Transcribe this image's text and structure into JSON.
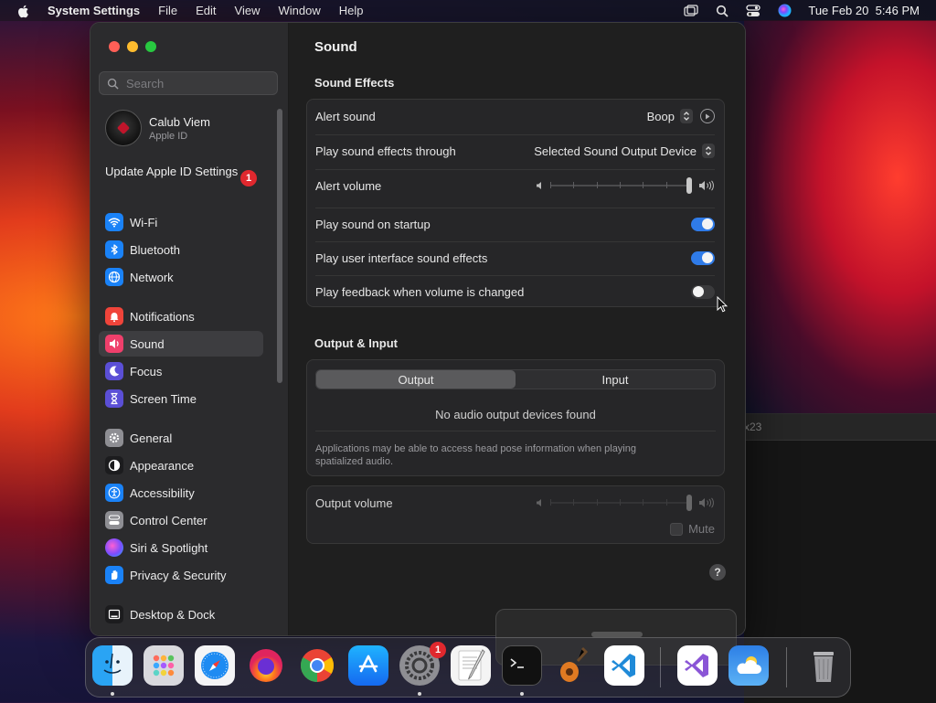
{
  "menubar": {
    "app_name": "System Settings",
    "menus": [
      "File",
      "Edit",
      "View",
      "Window",
      "Help"
    ],
    "clock": "Tue Feb 20  5:46 PM"
  },
  "background": {
    "terminal_fragment": "x23"
  },
  "sidebar": {
    "search_placeholder": "Search",
    "account": {
      "name": "Calub Viem",
      "subtitle": "Apple ID"
    },
    "update": {
      "label": "Update Apple ID Settings",
      "badge": "1"
    },
    "items": [
      {
        "label": "Wi-Fi",
        "icon": "wifi-icon",
        "color": "#1a82f7",
        "selected": false
      },
      {
        "label": "Bluetooth",
        "icon": "bluetooth-icon",
        "color": "#1a82f7",
        "selected": false
      },
      {
        "label": "Network",
        "icon": "globe-icon",
        "color": "#1a82f7",
        "selected": false
      },
      {
        "label": "Notifications",
        "icon": "bell-icon",
        "color": "#f0443a",
        "selected": false
      },
      {
        "label": "Sound",
        "icon": "speaker-icon",
        "color": "#ef3f6b",
        "selected": true
      },
      {
        "label": "Focus",
        "icon": "moon-icon",
        "color": "#5b4fd6",
        "selected": false
      },
      {
        "label": "Screen Time",
        "icon": "hourglass-icon",
        "color": "#5b4fd6",
        "selected": false
      },
      {
        "label": "General",
        "icon": "gear-icon",
        "color": "#8e8e93",
        "selected": false
      },
      {
        "label": "Appearance",
        "icon": "appearance-icon",
        "color": "#1c1c1e",
        "selected": false
      },
      {
        "label": "Accessibility",
        "icon": "accessibility-icon",
        "color": "#1a82f7",
        "selected": false
      },
      {
        "label": "Control Center",
        "icon": "control-center-icon",
        "color": "#8e8e93",
        "selected": false
      },
      {
        "label": "Siri & Spotlight",
        "icon": "siri-icon",
        "color": "#b44fd6",
        "selected": false
      },
      {
        "label": "Privacy & Security",
        "icon": "hand-icon",
        "color": "#1a82f7",
        "selected": false
      },
      {
        "label": "Desktop & Dock",
        "icon": "dock-icon",
        "color": "#1c1c1e",
        "selected": false
      }
    ]
  },
  "main": {
    "title": "Sound",
    "sound_effects": {
      "heading": "Sound Effects",
      "alert_sound": {
        "label": "Alert sound",
        "value": "Boop"
      },
      "play_through": {
        "label": "Play sound effects through",
        "value": "Selected Sound Output Device"
      },
      "alert_volume": {
        "label": "Alert volume",
        "level": 1.0
      },
      "startup": {
        "label": "Play sound on startup",
        "on": true
      },
      "ui_effects": {
        "label": "Play user interface sound effects",
        "on": true
      },
      "feedback": {
        "label": "Play feedback when volume is changed",
        "on": false
      }
    },
    "output_input": {
      "heading": "Output & Input",
      "tabs": [
        "Output",
        "Input"
      ],
      "selected_tab": "Output",
      "empty_message": "No audio output devices found",
      "note": "Applications may be able to access head pose information when playing spatialized audio."
    },
    "output_volume": {
      "label": "Output volume",
      "level": 1.0,
      "mute_label": "Mute",
      "muted": false
    },
    "help_label": "?"
  },
  "dock": {
    "apps": [
      "Finder",
      "Launchpad",
      "Safari",
      "Firefox",
      "Google Chrome",
      "App Store",
      "System Settings",
      "TextEdit",
      "Terminal",
      "GarageBand",
      "Visual Studio Code",
      "Visual Studio",
      "Weather",
      "Trash"
    ],
    "settings_badge": "1"
  }
}
